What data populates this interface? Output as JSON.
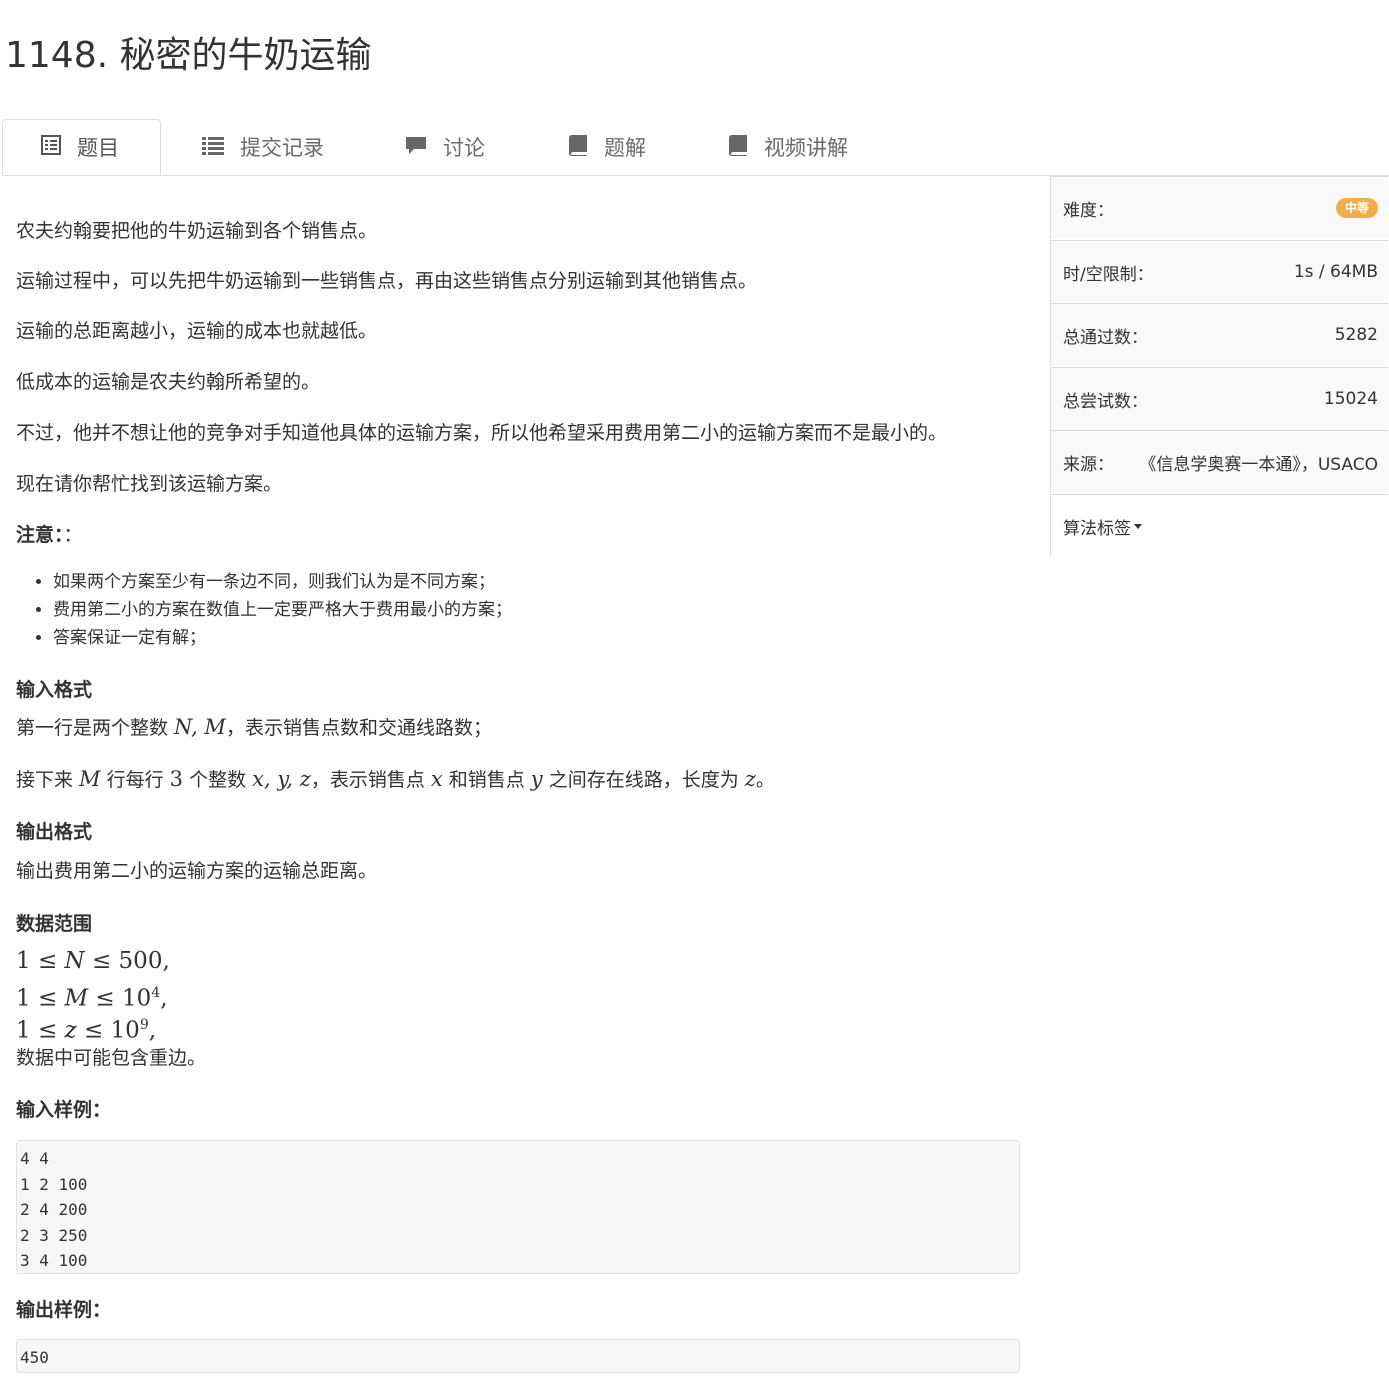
{
  "problem": {
    "title": "1148. 秘密的牛奶运输"
  },
  "tabs": [
    {
      "label": "题目",
      "icon": "list-alt-icon"
    },
    {
      "label": "提交记录",
      "icon": "list-icon"
    },
    {
      "label": "讨论",
      "icon": "comment-icon"
    },
    {
      "label": "题解",
      "icon": "book-icon"
    },
    {
      "label": "视频讲解",
      "icon": "book-icon"
    }
  ],
  "description": [
    "农夫约翰要把他的牛奶运输到各个销售点。",
    "运输过程中，可以先把牛奶运输到一些销售点，再由这些销售点分别运输到其他销售点。",
    "运输的总距离越小，运输的成本也就越低。",
    "低成本的运输是农夫约翰所希望的。",
    "不过，他并不想让他的竞争对手知道他具体的运输方案，所以他希望采用费用第二小的运输方案而不是最小的。",
    "现在请你帮忙找到该运输方案。"
  ],
  "note": {
    "heading": "注意：",
    "suffix": "：",
    "items": [
      "如果两个方案至少有一条边不同，则我们认为是不同方案；",
      "费用第二小的方案在数值上一定要严格大于费用最小的方案；",
      "答案保证一定有解；"
    ]
  },
  "input_format": {
    "heading": "输入格式",
    "line1_pre": "第一行是两个整数 ",
    "line1_math": "N, M",
    "line1_post": "，表示销售点数和交通线路数；",
    "line2_pre": "接下来 ",
    "line2_m": "M",
    "line2_mid1": " 行每行 ",
    "line2_three": "3",
    "line2_mid2": " 个整数 ",
    "line2_xyz": "x, y, z",
    "line2_mid3": "，表示销售点 ",
    "line2_x": "x",
    "line2_mid4": " 和销售点 ",
    "line2_y": "y",
    "line2_mid5": " 之间存在线路，长度为 ",
    "line2_z": "z",
    "line2_end": "。"
  },
  "output_format": {
    "heading": "输出格式",
    "text": "输出费用第二小的运输方案的运输总距离。"
  },
  "range": {
    "heading": "数据范围",
    "l1_pre": "1 ≤ ",
    "l1_var": "N",
    "l1_post": " ≤ 500,",
    "l2_pre": "1 ≤ ",
    "l2_var": "M",
    "l2_mid": " ≤ 10",
    "l2_exp": "4",
    "l2_end": ",",
    "l3_pre": "1 ≤ ",
    "l3_var": "z",
    "l3_mid": " ≤ 10",
    "l3_exp": "9",
    "l3_end": ",",
    "note": "数据中可能包含重边。"
  },
  "sample_input": {
    "heading": "输入样例：",
    "content": "4 4\n1 2 100\n2 4 200\n2 3 250\n3 4 100"
  },
  "sample_output": {
    "heading": "输出样例：",
    "content": "450"
  },
  "sidebar": {
    "difficulty_label": "难度：",
    "difficulty_value": "中等",
    "difficulty_color": "#f0ad4e",
    "limit_label": "时/空限制：",
    "limit_value": "1s / 64MB",
    "passed_label": "总通过数：",
    "passed_value": "5282",
    "tries_label": "总尝试数：",
    "tries_value": "15024",
    "source_label": "来源：",
    "source_value": "《信息学奥赛一本通》，USACO",
    "tags_label": "算法标签"
  }
}
